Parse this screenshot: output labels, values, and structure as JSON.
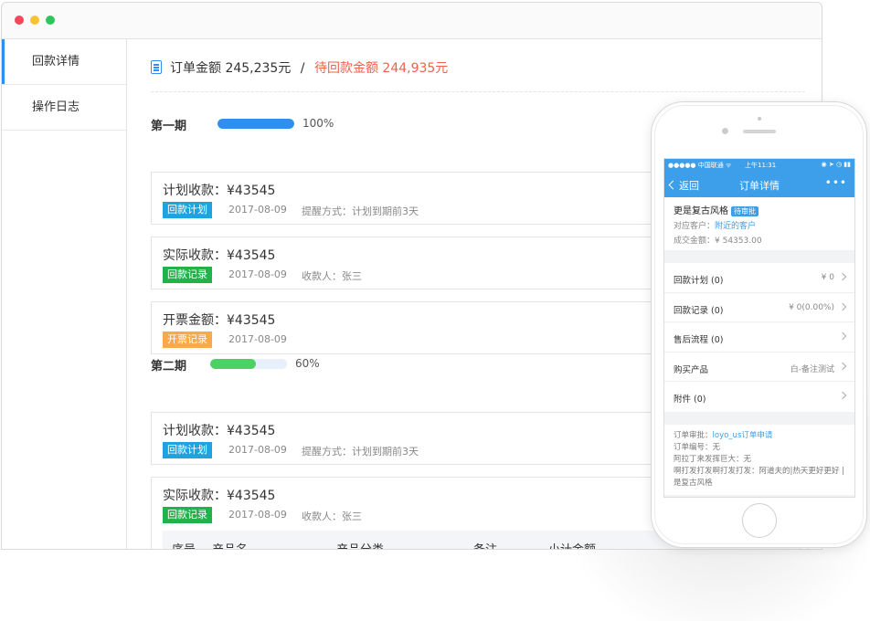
{
  "sidebar": {
    "items": [
      {
        "label": "回款详情",
        "active": true
      },
      {
        "label": "操作日志",
        "active": false
      }
    ]
  },
  "summary": {
    "order_amount": "订单金额 245,235元",
    "separator": "/",
    "pending_amount": "待回款金额 244,935元"
  },
  "phases": [
    {
      "title": "第一期",
      "progress": 1.0,
      "progress_label": "100%",
      "progress_color": "#2e8ff0",
      "cards": [
        {
          "title": "计划收款：¥43545",
          "tag": "回款计划",
          "tag_color": "blue",
          "date": "2017-08-09",
          "extra": "提醒方式：计划到期前3天"
        },
        {
          "title": "实际收款：¥43545",
          "tag": "回款记录",
          "tag_color": "green",
          "date": "2017-08-09",
          "extra": "收款人：张三"
        },
        {
          "title": "开票金额：¥43545",
          "tag": "开票记录",
          "tag_color": "orange",
          "date": "2017-08-09",
          "extra": ""
        }
      ]
    },
    {
      "title": "第二期",
      "progress": 0.6,
      "progress_label": "60%",
      "progress_color": "#4cd264",
      "cards": [
        {
          "title": "计划收款：¥43545",
          "tag": "回款计划",
          "tag_color": "blue",
          "date": "2017-08-09",
          "extra": "提醒方式：计划到期前3天"
        },
        {
          "title": "实际收款：¥43545",
          "tag": "回款记录",
          "tag_color": "green",
          "date": "2017-08-09",
          "extra": "收款人：张三"
        }
      ]
    }
  ],
  "product_table": {
    "columns": [
      "序号",
      "产品名",
      "产品分类",
      "备注",
      "小计金额"
    ]
  },
  "phone": {
    "status": {
      "carrier": "●●●●● 中国联通 ᯤ",
      "time": "上午11:31",
      "icons": "◉ ➤ ◷ ▮▮"
    },
    "nav": {
      "back": "返回",
      "title": "订单详情",
      "more": "•••"
    },
    "info": {
      "name": "更是复古风格",
      "badge": "待审批",
      "customer_label": "对应客户：",
      "customer_value": "附近的客户",
      "amount_label": "成交金额：",
      "amount_value": "¥ 54353.00"
    },
    "list": [
      {
        "label": "回款计划 (0)",
        "value": "¥ 0"
      },
      {
        "label": "回款记录 (0)",
        "value": "¥ 0(0.00%)"
      },
      {
        "label": "售后流程 (0)",
        "value": ""
      },
      {
        "label": "购买产品",
        "value": "白-备注测试"
      },
      {
        "label": "附件 (0)",
        "value": ""
      }
    ],
    "notes": {
      "approval_label": "订单审批：",
      "approval_value": "loyo_us订单申请",
      "number": "订单编号：无",
      "line3": "阿拉丁来发挥巨大：无",
      "line4": "啊打发打发啊打发打发：阿道夫的|热天更好更好 |是复古风格"
    }
  }
}
